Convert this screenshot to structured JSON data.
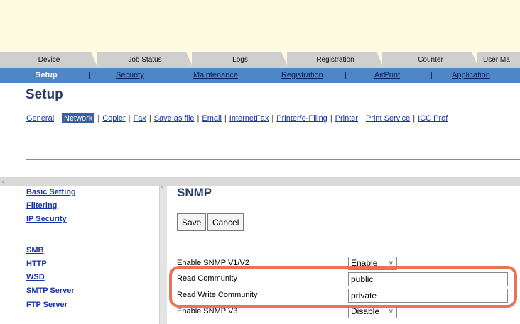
{
  "main_tabs": [
    "Device",
    "Job Status",
    "Logs",
    "Registration",
    "Counter",
    "User Ma"
  ],
  "sub_nav": {
    "items": [
      "Setup",
      "Security",
      "Maintenance",
      "Registration",
      "AirPrint",
      "Application"
    ],
    "active": "Setup",
    "separator": "|"
  },
  "setup": {
    "title": "Setup",
    "links": [
      "General",
      "Network",
      "Copier",
      "Fax",
      "Save as file",
      "Email",
      "InternetFax",
      "Printer/e-Filing",
      "Printer",
      "Print Service",
      "ICC Prof"
    ],
    "active": "Network",
    "separator": "|"
  },
  "scroll": {
    "left_arrow": "‹",
    "up_arrow": "^"
  },
  "left_nav": {
    "items": [
      "Basic Setting",
      "Filtering",
      "IP Security",
      "SMB",
      "HTTP",
      "WSD",
      "SMTP Server",
      "FTP Server"
    ]
  },
  "content": {
    "title": "SNMP",
    "save_label": "Save",
    "cancel_label": "Cancel",
    "rows": [
      {
        "label": "Enable SNMP V1/V2",
        "type": "select",
        "value": "Enable"
      },
      {
        "label": "Read Community",
        "type": "text",
        "value": "public"
      },
      {
        "label": "Read Write Community",
        "type": "text",
        "value": "private"
      },
      {
        "label": "Enable SNMP V3",
        "type": "select",
        "value": "Disable"
      }
    ]
  },
  "colors": {
    "banner": "#fdfbe0",
    "tab": "#cfcfcf",
    "sub_nav": "#4f86c6",
    "highlight": "#ea7357",
    "link": "#1633a8"
  },
  "icons": {
    "select_chevron": "chevron-down-icon"
  }
}
